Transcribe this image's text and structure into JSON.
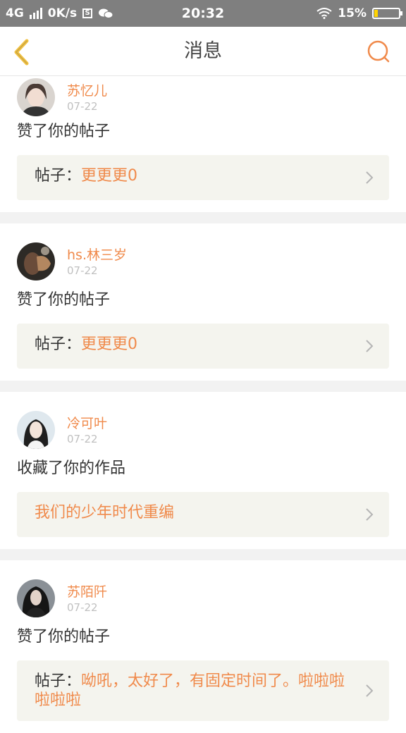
{
  "status_bar": {
    "network": "4G",
    "speed": "0K/s",
    "time": "20:32",
    "battery": "15%",
    "battery_level": 0.15
  },
  "header": {
    "title": "消息",
    "back_icon": "chevron-left-icon",
    "search_icon": "search-icon"
  },
  "colors": {
    "accent": "#f08a4b",
    "back_icon": "#f0c040",
    "ref_bg": "#f4f4ee"
  },
  "messages": [
    {
      "username": "苏忆儿",
      "time": "07-22",
      "action": "赞了你的帖子",
      "ref_prefix": "帖子：",
      "ref_title": "更更更0"
    },
    {
      "username": "hs.林三岁",
      "time": "07-22",
      "action": "赞了你的帖子",
      "ref_prefix": "帖子：",
      "ref_title": "更更更0"
    },
    {
      "username": "冷可叶",
      "time": "07-22",
      "action": "收藏了你的作品",
      "ref_prefix": "",
      "ref_title": "我们的少年时代重编"
    },
    {
      "username": "苏陌阡",
      "time": "07-22",
      "action": "赞了你的帖子",
      "ref_prefix": "帖子：",
      "ref_title": "呦吼，太好了，有固定时间了。啦啦啦啦啦啦"
    }
  ]
}
